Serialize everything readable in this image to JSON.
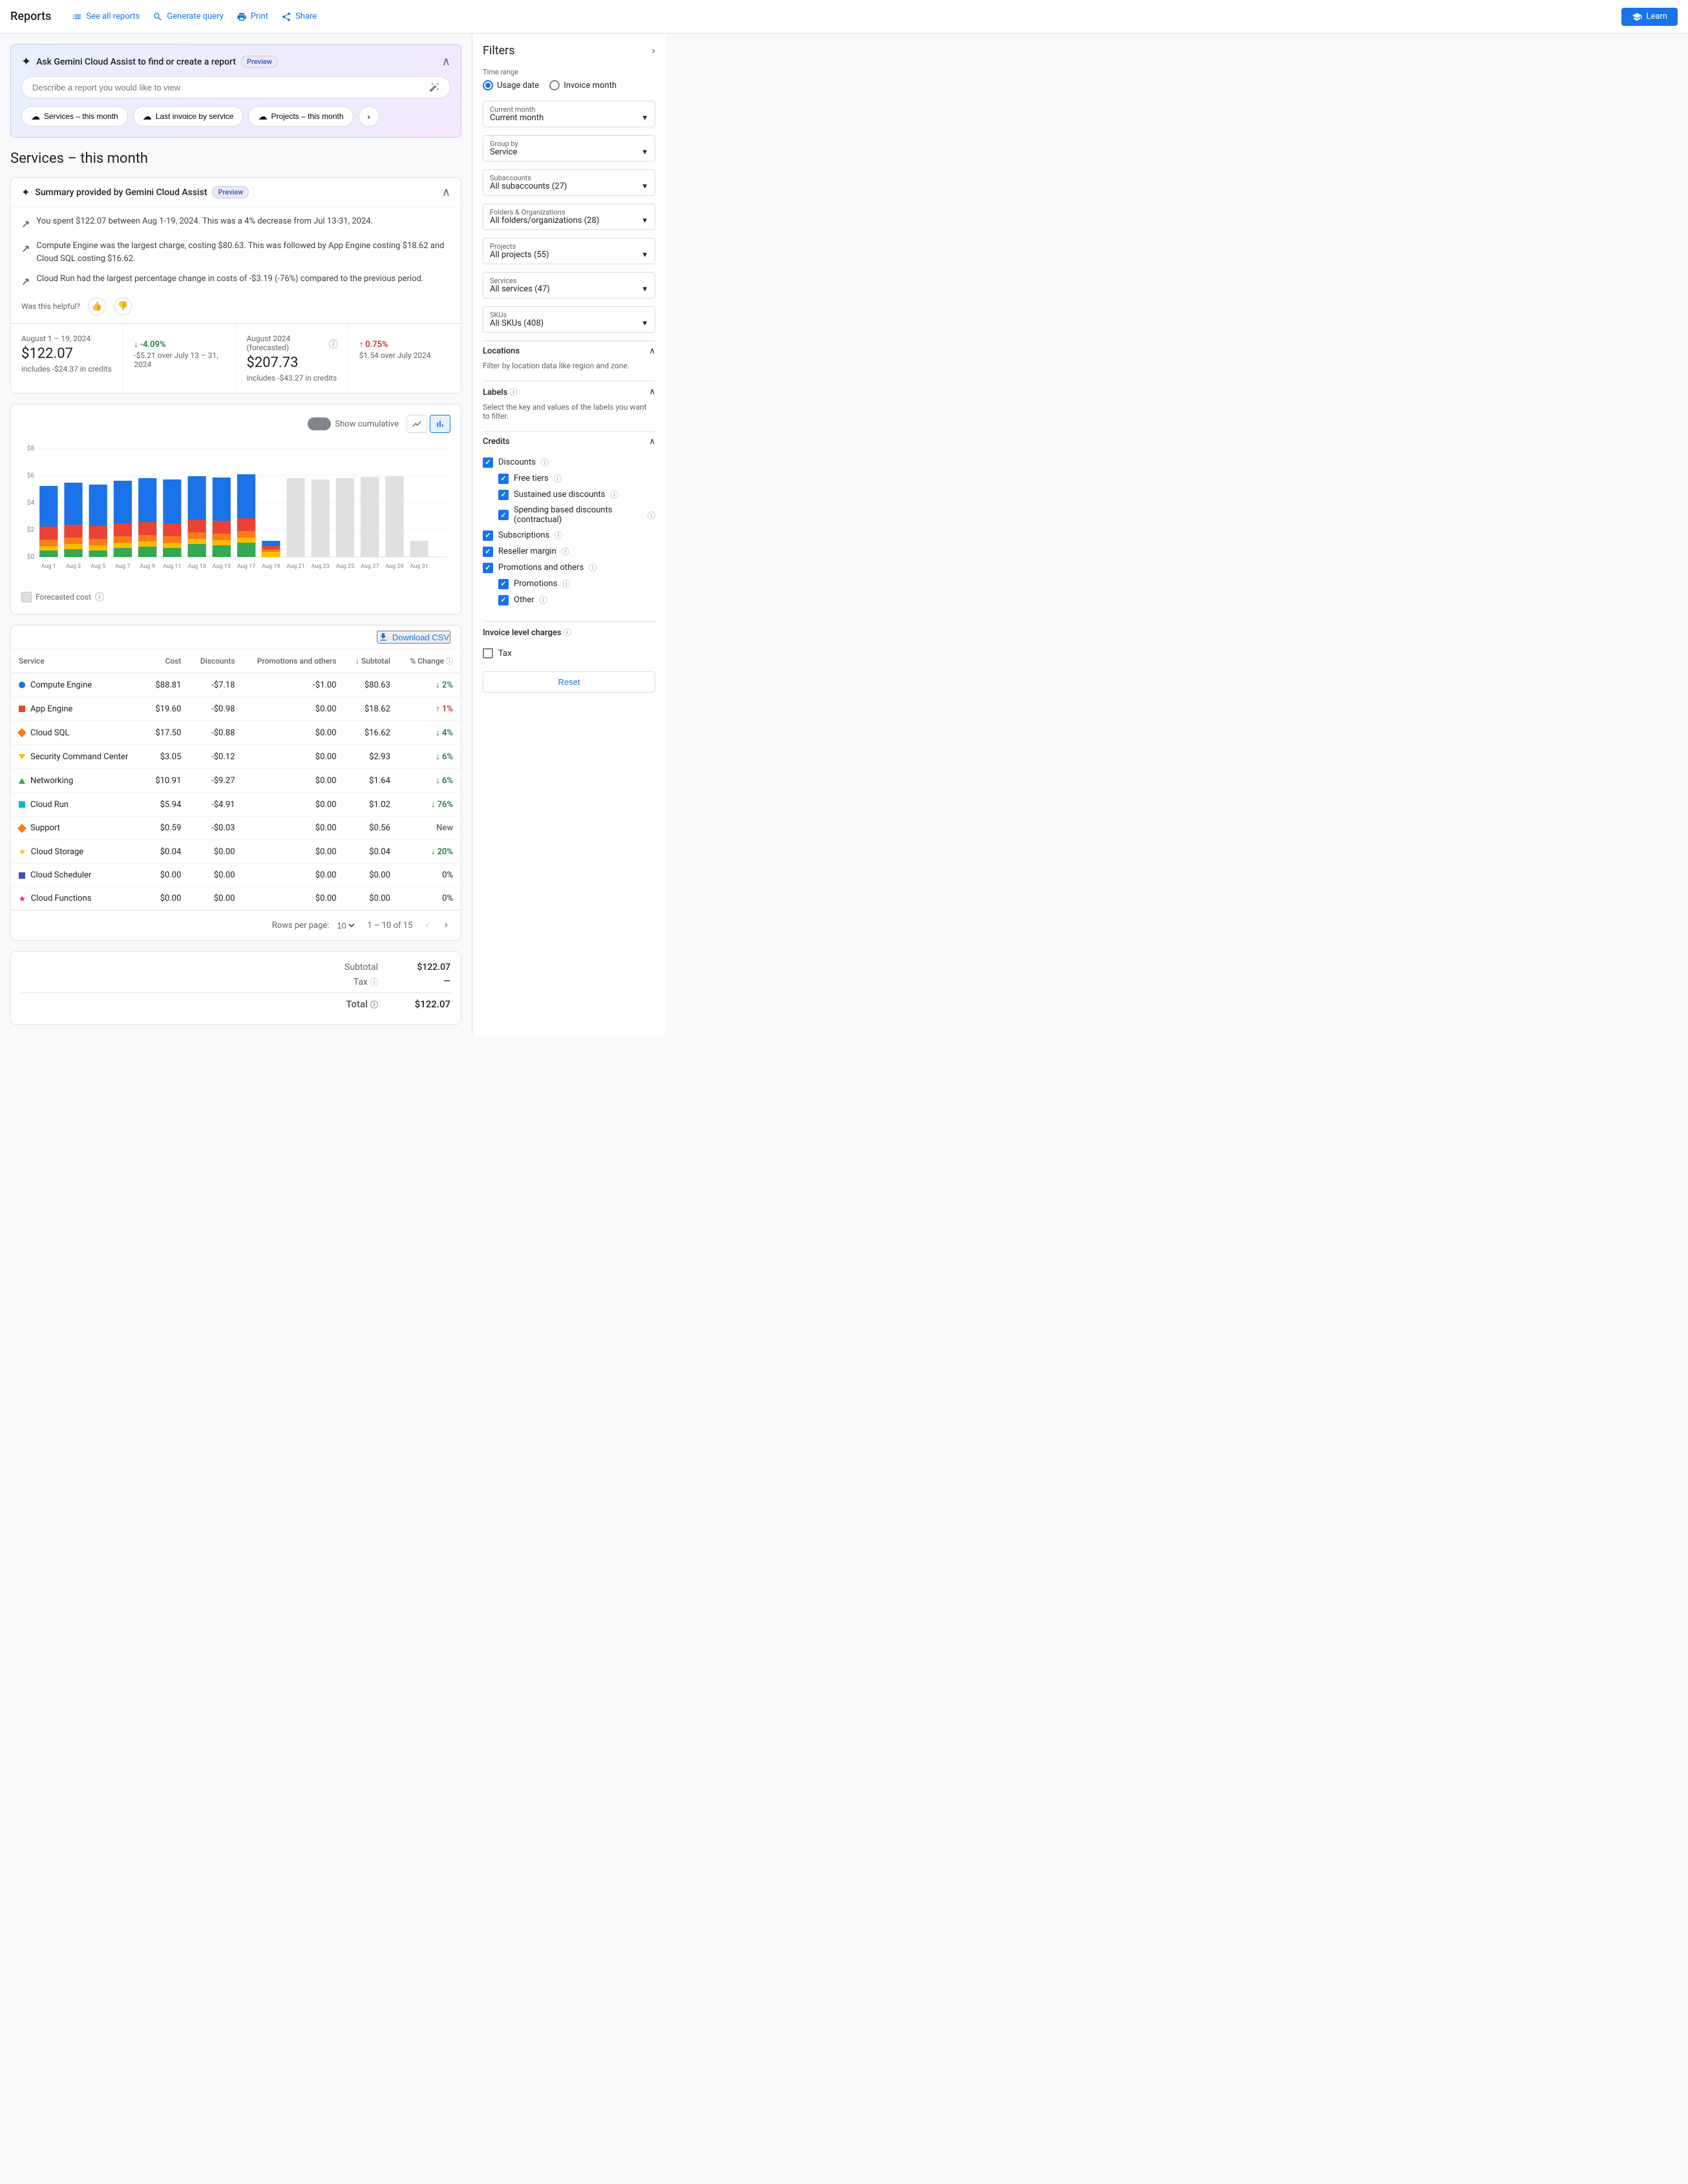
{
  "nav": {
    "title": "Reports",
    "actions": [
      {
        "label": "See all reports",
        "icon": "list-icon"
      },
      {
        "label": "Generate query",
        "icon": "search-icon"
      },
      {
        "label": "Print",
        "icon": "print-icon"
      },
      {
        "label": "Share",
        "icon": "share-icon"
      }
    ],
    "learn_label": "Learn"
  },
  "gemini": {
    "title": "Ask Gemini Cloud Assist to find or create a report",
    "preview_label": "Preview",
    "input_placeholder": "Describe a report you would like to view",
    "quick_reports": [
      {
        "label": "Services – this month"
      },
      {
        "label": "Last invoice by service"
      },
      {
        "label": "Projects – this month"
      }
    ]
  },
  "page_title": "Services – this month",
  "summary": {
    "title": "Summary provided by Gemini Cloud Assist",
    "preview_label": "Preview",
    "items": [
      "You spent $122.07 between Aug 1-19, 2024. This was a 4% decrease from Jul 13-31, 2024.",
      "Compute Engine was the largest charge, costing $80.63. This was followed by App Engine costing $18.62 and Cloud SQL costing $16.62.",
      "Cloud Run had the largest percentage change in costs of -$3.19 (-76%) compared to the previous period."
    ],
    "helpful_label": "Was this helpful?"
  },
  "metrics": [
    {
      "period": "August 1 – 19, 2024",
      "value": "$122.07",
      "sub": "includes -$24.37 in credits",
      "change": "-4.09%",
      "change_sub": "-$5.21 over July 13 – 31, 2024",
      "change_dir": "down",
      "change_color": "green"
    },
    {
      "period": "August 2024 (forecasted)",
      "value": "$207.73",
      "sub": "includes -$43.27 in credits",
      "change": "0.75%",
      "change_sub": "$1.54 over July 2024",
      "change_dir": "up",
      "change_color": "red"
    }
  ],
  "chart": {
    "show_cumulative": "Show cumulative",
    "y_labels": [
      "$8",
      "$6",
      "$4",
      "$2",
      "$0"
    ],
    "forecasted_legend": "Forecasted cost",
    "bars": [
      {
        "label": "Aug 1",
        "actual": 75,
        "forecasted": false
      },
      {
        "label": "Aug 3",
        "actual": 80,
        "forecasted": false
      },
      {
        "label": "Aug 5",
        "actual": 78,
        "forecasted": false
      },
      {
        "label": "Aug 7",
        "actual": 82,
        "forecasted": false
      },
      {
        "label": "Aug 9",
        "actual": 85,
        "forecasted": false
      },
      {
        "label": "Aug 11",
        "actual": 83,
        "forecasted": false
      },
      {
        "label": "Aug 13",
        "actual": 88,
        "forecasted": false
      },
      {
        "label": "Aug 15",
        "actual": 86,
        "forecasted": false
      },
      {
        "label": "Aug 17",
        "actual": 90,
        "forecasted": false
      },
      {
        "label": "Aug 19",
        "actual": 20,
        "forecasted": false
      },
      {
        "label": "Aug 21",
        "actual": 0,
        "forecasted": true,
        "f_val": 80
      },
      {
        "label": "Aug 23",
        "actual": 0,
        "forecasted": true,
        "f_val": 82
      },
      {
        "label": "Aug 25",
        "actual": 0,
        "forecasted": true,
        "f_val": 80
      },
      {
        "label": "Aug 27",
        "actual": 0,
        "forecasted": true,
        "f_val": 82
      },
      {
        "label": "Aug 29",
        "actual": 0,
        "forecasted": true,
        "f_val": 83
      },
      {
        "label": "Aug 31",
        "actual": 0,
        "forecasted": true,
        "f_val": 5
      }
    ]
  },
  "table": {
    "download_label": "Download CSV",
    "headers": [
      "Service",
      "Cost",
      "Discounts",
      "Promotions and others",
      "Subtotal",
      "% Change"
    ],
    "rows": [
      {
        "service": "Compute Engine",
        "cost": "$88.81",
        "discounts": "-$7.18",
        "promos": "-$1.00",
        "subtotal": "$80.63",
        "change": "2%",
        "change_dir": "down",
        "change_color": "green",
        "icon": "circle",
        "color": "#1a73e8"
      },
      {
        "service": "App Engine",
        "cost": "$19.60",
        "discounts": "-$0.98",
        "promos": "$0.00",
        "subtotal": "$18.62",
        "change": "1%",
        "change_dir": "up",
        "change_color": "red",
        "icon": "square",
        "color": "#ea4335"
      },
      {
        "service": "Cloud SQL",
        "cost": "$17.50",
        "discounts": "-$0.88",
        "promos": "$0.00",
        "subtotal": "$16.62",
        "change": "4%",
        "change_dir": "down",
        "change_color": "green",
        "icon": "diamond",
        "color": "#fa7b17"
      },
      {
        "service": "Security Command Center",
        "cost": "$3.05",
        "discounts": "-$0.12",
        "promos": "$0.00",
        "subtotal": "$2.93",
        "change": "6%",
        "change_dir": "down",
        "change_color": "green",
        "icon": "down-tri",
        "color": "#fbbc04"
      },
      {
        "service": "Networking",
        "cost": "$10.91",
        "discounts": "-$9.27",
        "promos": "$0.00",
        "subtotal": "$1.64",
        "change": "6%",
        "change_dir": "down",
        "change_color": "green",
        "icon": "up-tri",
        "color": "#34a853"
      },
      {
        "service": "Cloud Run",
        "cost": "$5.94",
        "discounts": "-$4.91",
        "promos": "$0.00",
        "subtotal": "$1.02",
        "change": "76%",
        "change_dir": "down",
        "change_color": "green",
        "icon": "square",
        "color": "#00bcd4"
      },
      {
        "service": "Support",
        "cost": "$0.59",
        "discounts": "-$0.03",
        "promos": "$0.00",
        "subtotal": "$0.56",
        "change": "New",
        "change_dir": "none",
        "change_color": "none",
        "icon": "diamond",
        "color": "#fa7b17"
      },
      {
        "service": "Cloud Storage",
        "cost": "$0.04",
        "discounts": "$0.00",
        "promos": "$0.00",
        "subtotal": "$0.04",
        "change": "20%",
        "change_dir": "down",
        "change_color": "green",
        "icon": "star",
        "color": "#fbbc04"
      },
      {
        "service": "Cloud Scheduler",
        "cost": "$0.00",
        "discounts": "$0.00",
        "promos": "$0.00",
        "subtotal": "$0.00",
        "change": "0%",
        "change_dir": "none",
        "change_color": "none",
        "icon": "square",
        "color": "#3f51b5"
      },
      {
        "service": "Cloud Functions",
        "cost": "$0.00",
        "discounts": "$0.00",
        "promos": "$0.00",
        "subtotal": "$0.00",
        "change": "0%",
        "change_dir": "none",
        "change_color": "none",
        "icon": "star",
        "color": "#e91e63"
      }
    ],
    "pagination": {
      "rows_per_page": "Rows per page:",
      "rows_per_page_value": "10",
      "page_info": "1 – 10 of 15"
    }
  },
  "totals": {
    "subtotal_label": "Subtotal",
    "subtotal_value": "$122.07",
    "tax_label": "Tax",
    "tax_value": "—",
    "total_label": "Total",
    "total_value": "$122.07"
  },
  "filters": {
    "title": "Filters",
    "time_range_label": "Time range",
    "usage_date_label": "Usage date",
    "invoice_month_label": "Invoice month",
    "current_month_label": "Current month",
    "group_by_label": "Group by",
    "group_by_value": "Service",
    "subaccounts_label": "Subaccounts",
    "subaccounts_value": "All subaccounts (27)",
    "folders_label": "Folders & Organizations",
    "folders_value": "All folders/organizations (28)",
    "projects_label": "Projects",
    "projects_value": "All projects (55)",
    "services_label": "Services",
    "services_value": "All services (47)",
    "skus_label": "SKUs",
    "skus_value": "All SKUs (408)",
    "locations_label": "Locations",
    "locations_sub": "Filter by location data like region and zone.",
    "labels_label": "Labels",
    "labels_sub": "Select the key and values of the labels you want to filter.",
    "credits_label": "Credits",
    "discounts_label": "Discounts",
    "credits_items": [
      {
        "label": "Free tiers",
        "checked": true,
        "indent": true
      },
      {
        "label": "Sustained use discounts",
        "checked": true,
        "indent": true
      },
      {
        "label": "Spending based discounts (contractual)",
        "checked": true,
        "indent": true
      }
    ],
    "subscriptions_label": "Subscriptions",
    "reseller_margin_label": "Reseller margin",
    "promotions_label": "Promotions and others",
    "promotions_items": [
      {
        "label": "Promotions",
        "checked": true,
        "indent": true
      },
      {
        "label": "Other",
        "checked": true,
        "indent": true
      }
    ],
    "invoice_level_label": "Invoice level charges",
    "tax_label": "Tax",
    "reset_label": "Reset"
  }
}
